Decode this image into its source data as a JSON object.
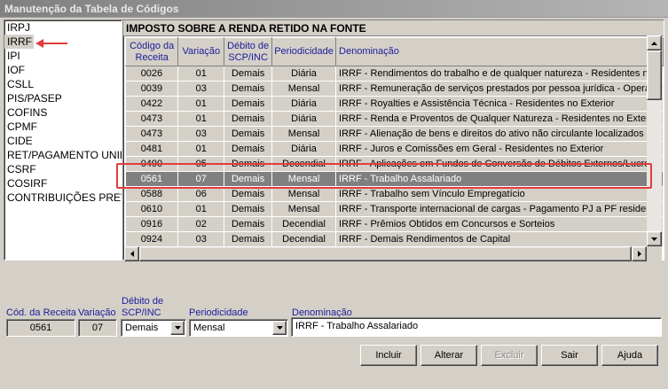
{
  "window": {
    "title": "Manutenção da Tabela de Códigos"
  },
  "left_list": {
    "items": [
      "IRPJ",
      "IRRF",
      "IPI",
      "IOF",
      "CSLL",
      "PIS/PASEP",
      "COFINS",
      "CPMF",
      "CIDE",
      "RET/PAGAMENTO UNIFI",
      "CSRF",
      "COSIRF",
      "CONTRIBUIÇÕES PREVID"
    ],
    "selected": "IRRF"
  },
  "grid": {
    "title": "IMPOSTO SOBRE A RENDA RETIDO NA FONTE",
    "columns": [
      "Código da Receita",
      "Variação",
      "Débito de SCP/INC",
      "Periodicidade",
      "Denominação"
    ],
    "rows": [
      [
        "0026",
        "01",
        "Demais",
        "Diária",
        "IRRF - Rendimentos do trabalho e de qualquer natureza - Residentes no"
      ],
      [
        "0039",
        "03",
        "Demais",
        "Mensal",
        "IRRF - Remuneração de serviços prestados por pessoa jurídica - Opera"
      ],
      [
        "0422",
        "01",
        "Demais",
        "Diária",
        "IRRF - Royalties e Assistência Técnica - Residentes no Exterior"
      ],
      [
        "0473",
        "01",
        "Demais",
        "Diária",
        "IRRF - Renda e Proventos de Qualquer Natureza - Residentes no Exterior"
      ],
      [
        "0473",
        "03",
        "Demais",
        "Mensal",
        "IRRF - Alienação de bens e direitos do ativo não circulante localizados no"
      ],
      [
        "0481",
        "01",
        "Demais",
        "Diária",
        "IRRF - Juros e Comissões em Geral - Residentes no Exterior"
      ],
      [
        "0490",
        "05",
        "Demais",
        "Decendial",
        "IRRF - Aplicações em Fundos de Conversão de Débitos Externos/Lucros"
      ],
      [
        "0561",
        "07",
        "Demais",
        "Mensal",
        "IRRF - Trabalho Assalariado"
      ],
      [
        "0588",
        "06",
        "Demais",
        "Mensal",
        "IRRF - Trabalho sem Vínculo Empregatício"
      ],
      [
        "0610",
        "01",
        "Demais",
        "Mensal",
        "IRRF - Transporte internacional de cargas - Pagamento PJ a PF residente"
      ],
      [
        "0916",
        "02",
        "Demais",
        "Decendial",
        "IRRF - Prêmios Obtidos em Concursos e Sorteios"
      ],
      [
        "0924",
        "03",
        "Demais",
        "Decendial",
        "IRRF - Demais Rendimentos de Capital"
      ]
    ],
    "selected_row_index": 7
  },
  "form": {
    "cod_receita_label": "Cód. da Receita",
    "cod_receita_value": "0561",
    "variacao_label": "Variação",
    "variacao_value": "07",
    "debito_label_line1": "Débito de",
    "debito_label_line2": "SCP/INC",
    "debito_value": "Demais",
    "periodicidade_label": "Periodicidade",
    "periodicidade_value": "Mensal",
    "denominacao_label": "Denominação",
    "denominacao_value": "IRRF - Trabalho Assalariado"
  },
  "buttons": {
    "incluir": "Incluir",
    "alterar": "Alterar",
    "excluir": "Excluir",
    "sair": "Sair",
    "ajuda": "Ajuda"
  },
  "colors": {
    "annotation_red": "#e43b3b",
    "label_blue": "#1c1c9a",
    "selection_gray": "#808080"
  }
}
